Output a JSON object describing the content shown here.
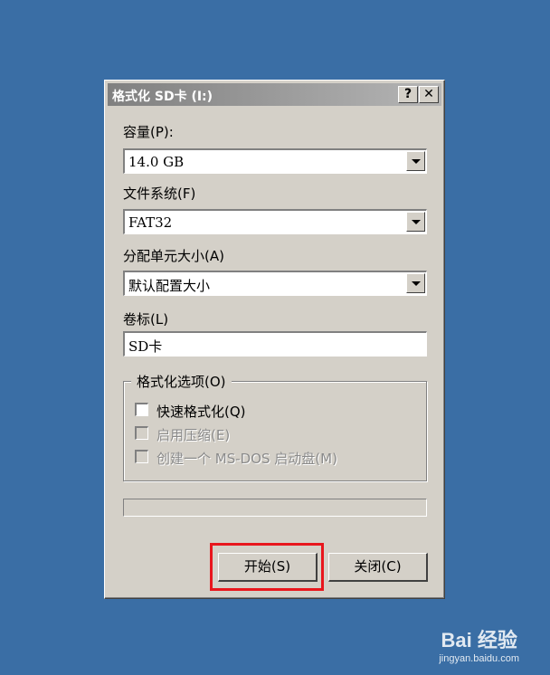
{
  "window": {
    "title": "格式化 SD卡 (I:)",
    "help_label": "?",
    "close_label": "✕"
  },
  "capacity": {
    "label": "容量(P):",
    "value": "14.0 GB"
  },
  "file_system": {
    "label": "文件系统(F)",
    "value": "FAT32"
  },
  "allocation_unit": {
    "label": "分配单元大小(A)",
    "value": "默认配置大小"
  },
  "volume_label": {
    "label": "卷标(L)",
    "value": "SD卡"
  },
  "format_options": {
    "legend": "格式化选项(O)",
    "options": [
      {
        "label": "快速格式化(Q)",
        "checked": false,
        "enabled": true
      },
      {
        "label": "启用压缩(E)",
        "checked": false,
        "enabled": false
      },
      {
        "label": "创建一个 MS-DOS 启动盘(M)",
        "checked": false,
        "enabled": false
      }
    ]
  },
  "progress": {
    "value": 0
  },
  "buttons": {
    "start_label": "开始(S)",
    "close_label": "关闭(C)"
  },
  "colors": {
    "desktop": "#3a6ea5",
    "dialog": "#d4d0c8",
    "highlight": "#e8161d"
  },
  "watermark": {
    "brand": "Bai 经验",
    "url": "jingyan.baidu.com"
  }
}
